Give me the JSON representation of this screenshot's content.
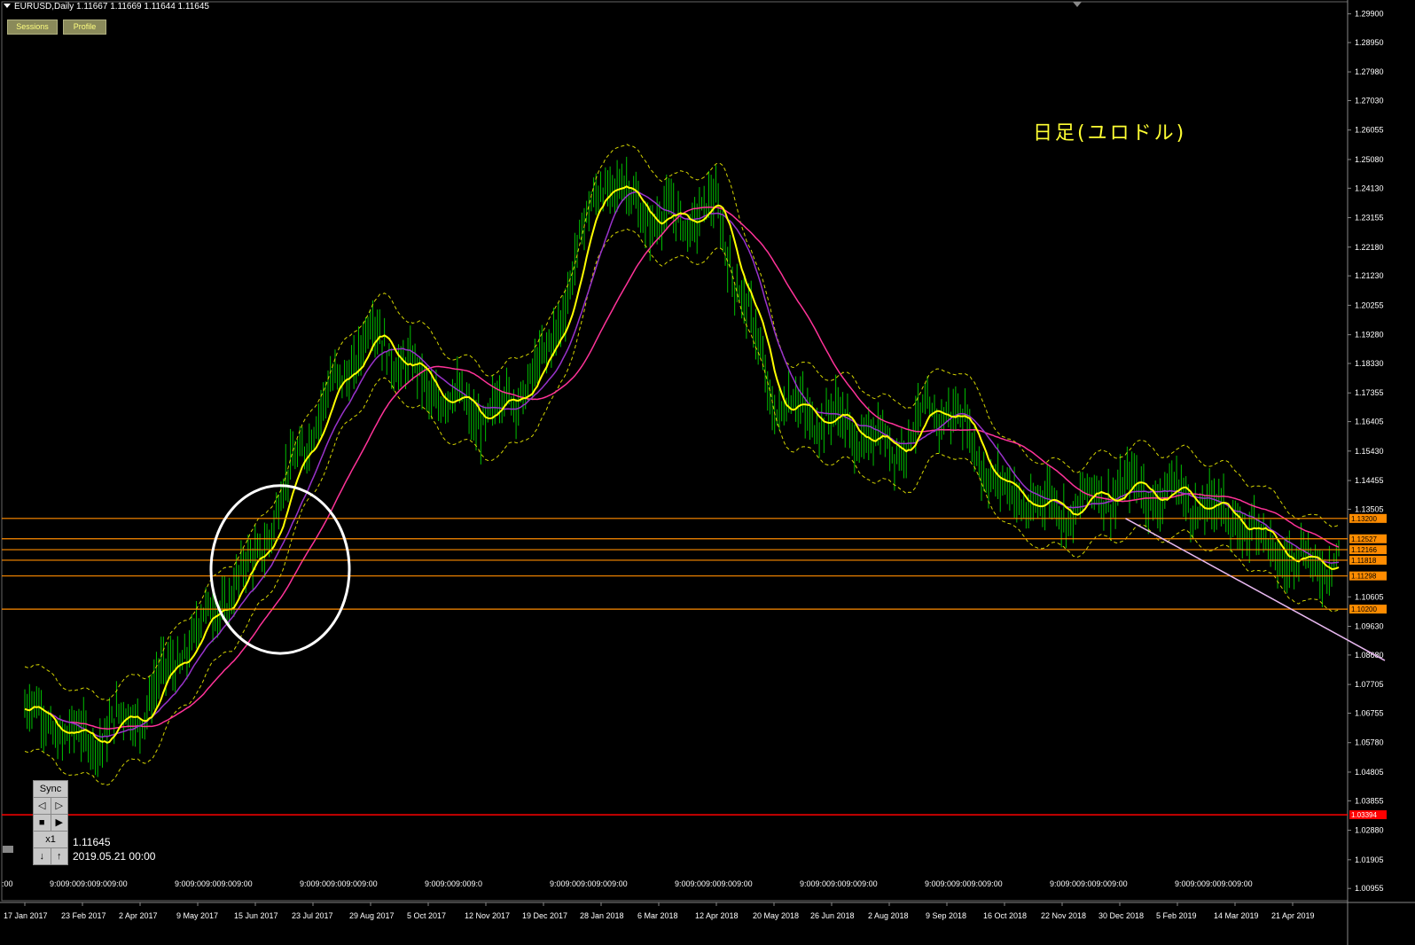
{
  "header": {
    "symbol_info": "EURUSD,Daily  1.11667 1.11669 1.11644 1.11645",
    "sessions_label": "Sessions",
    "profile_label": "Profile"
  },
  "annotation_title": "日足(ユロドル)",
  "replay_panel": {
    "sync_label": "Sync",
    "step_back": "◁",
    "step_fwd": "▷",
    "stop": "■",
    "play": "▶",
    "speed": "x1",
    "down": "↓",
    "up": "↑",
    "price": "1.11645",
    "datetime": "2019.05.21 00:00"
  },
  "colors": {
    "background": "#000000",
    "candle": "#00c000",
    "ma_fast": "#ffff00",
    "ma_medium": "#9933cc",
    "ma_slow": "#ff3399",
    "envelope": "#d4d400",
    "level_line": "#ff8c00",
    "level_label_bg": "#ff8c00",
    "red_line": "#ff0000",
    "trendline": "#e8b8f0",
    "circle": "#ffffff"
  },
  "chart_data": {
    "type": "candlestick",
    "title": "",
    "y_axis": {
      "ticks": [
        "1.29900",
        "1.28950",
        "1.27980",
        "1.27030",
        "1.26055",
        "1.25080",
        "1.24130",
        "1.23155",
        "1.22180",
        "1.21230",
        "1.20255",
        "1.19280",
        "1.18330",
        "1.17355",
        "1.16405",
        "1.15430",
        "1.14455",
        "1.13505",
        "1.10605",
        "1.09630",
        "1.08680",
        "1.07705",
        "1.06755",
        "1.05780",
        "1.04805",
        "1.03855",
        "1.02880",
        "1.01905",
        "1.00955"
      ],
      "range": [
        1.0055,
        1.303
      ]
    },
    "x_axis": {
      "ticks": [
        "17 Jan 2017",
        "23 Feb 2017",
        "2 Apr 2017",
        "9 May 2017",
        "15 Jun 2017",
        "23 Jul 2017",
        "29 Aug 2017",
        "5 Oct 2017",
        "12 Nov 2017",
        "19 Dec 2017",
        "28 Jan 2018",
        "6 Mar 2018",
        "12 Apr 2018",
        "20 May 2018",
        "26 Jun 2018",
        "2 Aug 2018",
        "9 Sep 2018",
        "16 Oct 2018",
        "22 Nov 2018",
        "30 Dec 2018",
        "5 Feb 2019",
        "14 Mar 2019",
        "21 Apr 2019"
      ],
      "session_row": [
        "9:009:009:009:009:00",
        "9:009:009:009:009:00",
        "9:009:009:009:009:00",
        "9:009:009:009:0",
        "9:009:009:009:009:00",
        "9:009:009:009:009:00",
        "9:009:009:009:009:00",
        "9:009:009:009:009:00",
        "9:009:009:009:009:00",
        "9:009:009:009:009:00"
      ],
      "session_row_left": ":00"
    },
    "price_keypoints": [
      [
        "17 Jan 2017",
        1.069
      ],
      [
        "23 Feb 2017",
        1.058
      ],
      [
        "2 Apr 2017",
        1.068
      ],
      [
        "9 May 2017",
        1.095
      ],
      [
        "15 Jun 2017",
        1.118
      ],
      [
        "23 Jul 2017",
        1.164
      ],
      [
        "29 Aug 2017",
        1.194
      ],
      [
        "5 Oct 2017",
        1.175
      ],
      [
        "12 Nov 2017",
        1.165
      ],
      [
        "19 Dec 2017",
        1.182
      ],
      [
        "28 Jan 2018",
        1.245
      ],
      [
        "6 Mar 2018",
        1.23
      ],
      [
        "12 Apr 2018",
        1.234
      ],
      [
        "20 May 2018",
        1.17
      ],
      [
        "26 Jun 2018",
        1.165
      ],
      [
        "2 Aug 2018",
        1.155
      ],
      [
        "9 Sep 2018",
        1.17
      ],
      [
        "16 Oct 2018",
        1.14
      ],
      [
        "22 Nov 2018",
        1.135
      ],
      [
        "30 Dec 2018",
        1.142
      ],
      [
        "5 Feb 2019",
        1.14
      ],
      [
        "14 Mar 2019",
        1.132
      ],
      [
        "21 Apr 2019",
        1.118
      ]
    ],
    "levels": [
      {
        "price": 1.132,
        "label": "1.13200"
      },
      {
        "price": 1.12527,
        "label": "1.12527"
      },
      {
        "price": 1.12166,
        "label": "1.12166"
      },
      {
        "price": 1.11818,
        "label": "1.11818"
      },
      {
        "price": 1.11298,
        "label": "1.11298"
      },
      {
        "price": 1.102,
        "label": "1.10200"
      }
    ],
    "red_level": {
      "price": 1.03394,
      "label": "1.03394"
    },
    "annotation_circle": {
      "date_from": "2 Apr 2017",
      "date_to": "23 Jul 2017",
      "price_from": 1.102,
      "price_to": 1.137
    },
    "trendline": {
      "from": [
        "30 Dec 2018",
        1.132
      ],
      "to": [
        "beyond 21 Apr 2019",
        1.085
      ]
    }
  }
}
